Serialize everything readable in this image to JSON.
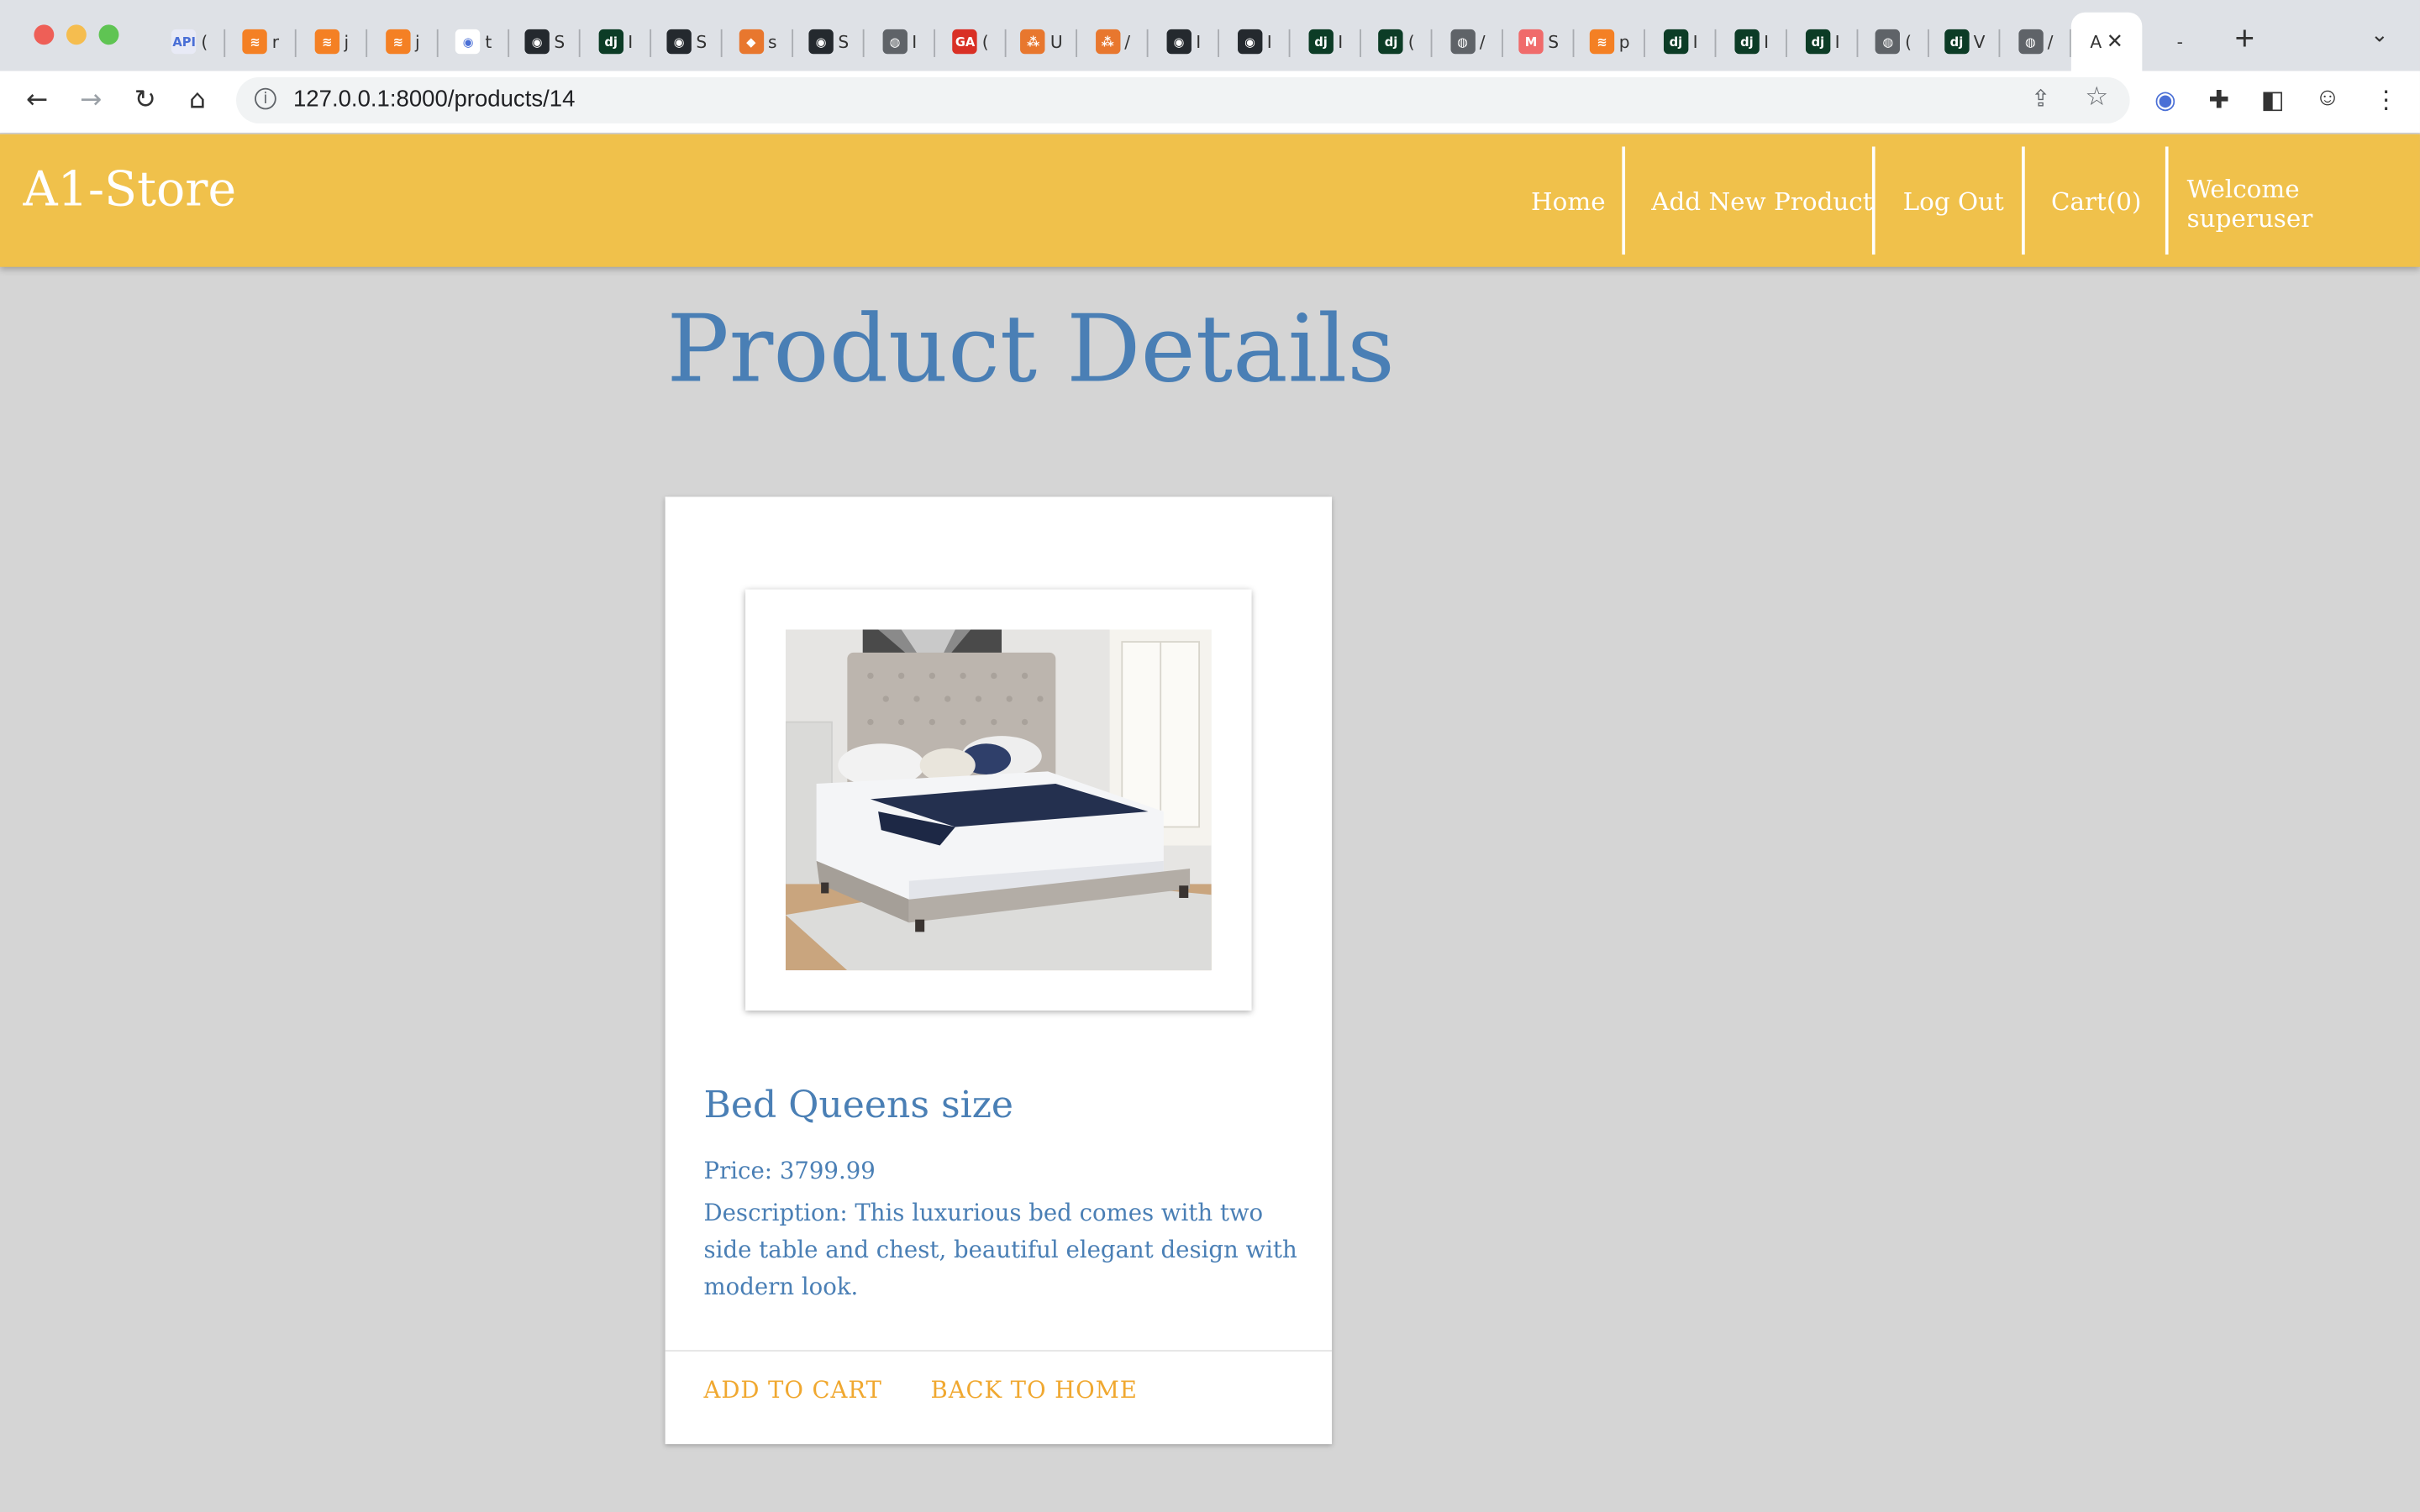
{
  "browser": {
    "tabs": [
      {
        "icon": "api-docs-icon",
        "title": "(",
        "color": "#e8eaf6",
        "glyph": "API"
      },
      {
        "icon": "stackoverflow-icon",
        "title": "r",
        "color": "#f48024",
        "glyph": "≋"
      },
      {
        "icon": "stackoverflow-icon",
        "title": "j",
        "color": "#f48024",
        "glyph": "≋"
      },
      {
        "icon": "stackoverflow-icon",
        "title": "j",
        "color": "#f48024",
        "glyph": "≋"
      },
      {
        "icon": "github-icon",
        "title": "t",
        "color": "#ffffff",
        "glyph": "◉"
      },
      {
        "icon": "github-icon",
        "title": "S",
        "color": "#24292e",
        "glyph": "◉"
      },
      {
        "icon": "django-icon",
        "title": "I",
        "color": "#0c3c26",
        "glyph": "dj"
      },
      {
        "icon": "github-icon",
        "title": "S",
        "color": "#24292e",
        "glyph": "◉"
      },
      {
        "icon": "package-icon",
        "title": "s",
        "color": "#e8772e",
        "glyph": "◆"
      },
      {
        "icon": "github-icon",
        "title": "S",
        "color": "#24292e",
        "glyph": "◉"
      },
      {
        "icon": "globe-icon",
        "title": "I",
        "color": "#5f6368",
        "glyph": "◍"
      },
      {
        "icon": "ga-icon",
        "title": "(",
        "color": "#d93025",
        "glyph": "GA"
      },
      {
        "icon": "tree-icon",
        "title": "U",
        "color": "#e8772e",
        "glyph": "⁂"
      },
      {
        "icon": "tree-icon",
        "title": "/",
        "color": "#e8772e",
        "glyph": "⁂"
      },
      {
        "icon": "github-icon",
        "title": "I",
        "color": "#24292e",
        "glyph": "◉"
      },
      {
        "icon": "github-icon",
        "title": "I",
        "color": "#24292e",
        "glyph": "◉"
      },
      {
        "icon": "django-icon",
        "title": "I",
        "color": "#0c3c26",
        "glyph": "dj"
      },
      {
        "icon": "django-icon",
        "title": "(",
        "color": "#0c3c26",
        "glyph": "dj"
      },
      {
        "icon": "globe-icon",
        "title": "/",
        "color": "#5f6368",
        "glyph": "◍"
      },
      {
        "icon": "m-icon",
        "title": "S",
        "color": "#f06b6b",
        "glyph": "M"
      },
      {
        "icon": "stackoverflow-icon",
        "title": "p",
        "color": "#f48024",
        "glyph": "≋"
      },
      {
        "icon": "django-icon",
        "title": "I",
        "color": "#0c3c26",
        "glyph": "dj"
      },
      {
        "icon": "django-icon",
        "title": "I",
        "color": "#0c3c26",
        "glyph": "dj"
      },
      {
        "icon": "django-icon",
        "title": "I",
        "color": "#0c3c26",
        "glyph": "dj"
      },
      {
        "icon": "globe-icon",
        "title": "(",
        "color": "#5f6368",
        "glyph": "◍"
      },
      {
        "icon": "django-icon",
        "title": "V",
        "color": "#0c3c26",
        "glyph": "dj"
      },
      {
        "icon": "globe-icon",
        "title": "/",
        "color": "#5f6368",
        "glyph": "◍"
      }
    ],
    "active_tab_title": "A",
    "extra_tab_title": "-",
    "url": "127.0.0.1:8000/products/14"
  },
  "nav": {
    "brand": "A1-Store",
    "home": "Home",
    "add_product": "Add New Product",
    "logout": "Log Out",
    "cart": "Cart(0)",
    "welcome": "Welcome superuser"
  },
  "page": {
    "title": "Product Details"
  },
  "product": {
    "name": "Bed Queens size",
    "price": "Price: 3799.99",
    "description": "Description: This luxurious bed comes with two side table and chest, beautiful elegant design with modern look.",
    "add_to_cart": "ADD TO CART",
    "back_home": "BACK TO HOME"
  },
  "colors": {
    "navbar": "#f0c14b",
    "title_blue": "#4a7fb5",
    "action_orange": "#f0a830",
    "page_bg": "#d5d5d5"
  }
}
